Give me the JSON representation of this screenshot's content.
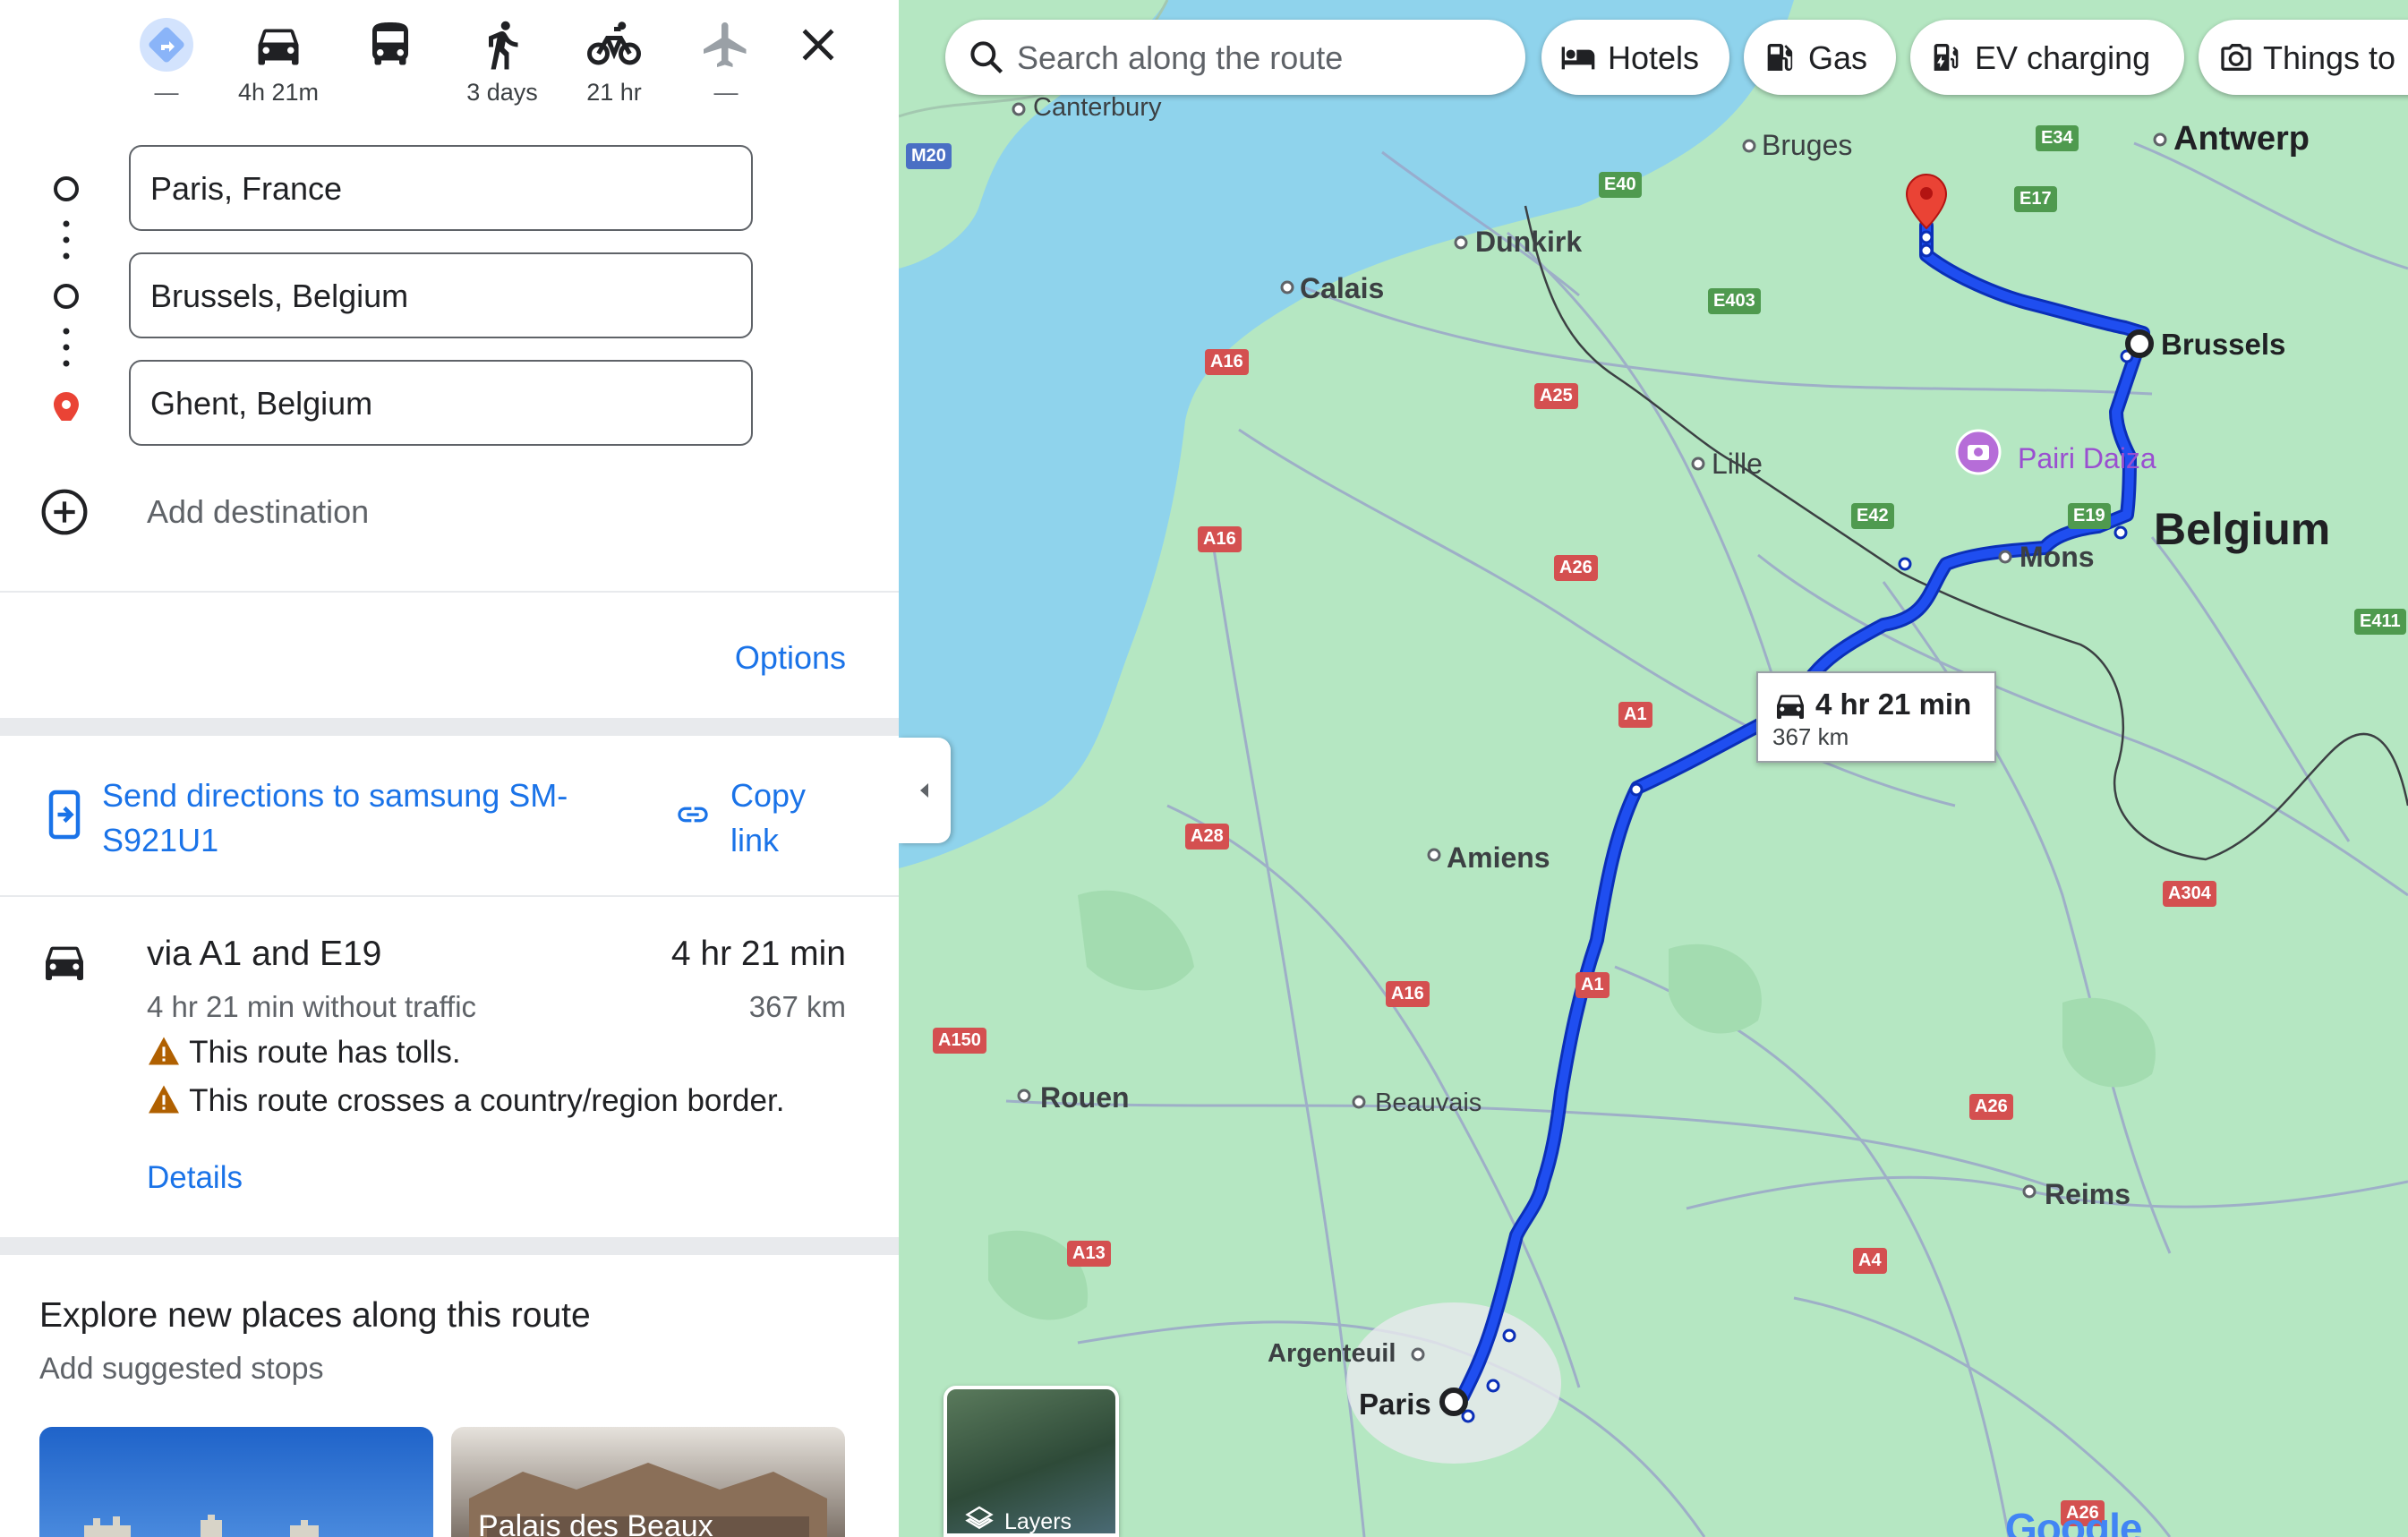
{
  "travel_modes": [
    {
      "name": "best",
      "label": "—"
    },
    {
      "name": "driving",
      "label": "4h 21m"
    },
    {
      "name": "transit",
      "label": ""
    },
    {
      "name": "walking",
      "label": "3 days"
    },
    {
      "name": "cycling",
      "label": "21 hr"
    },
    {
      "name": "flights",
      "label": "—"
    }
  ],
  "waypoints": [
    {
      "value": "Paris, France"
    },
    {
      "value": "Brussels, Belgium"
    },
    {
      "value": "Ghent, Belgium"
    }
  ],
  "add_destination": "Add destination",
  "options_label": "Options",
  "send_directions_label": "Send directions to samsung SM-S921U1",
  "send_line1": "Send directions to samsung SM-",
  "send_line2": "S921U1",
  "copy_link_line1": "Copy",
  "copy_link_line2": "link",
  "route": {
    "via": "via A1 and E19",
    "duration": "4 hr 21 min",
    "without_traffic": "4 hr 21 min without traffic",
    "distance": "367 km",
    "warnings": [
      "This route has tolls.",
      "This route crosses a country/region border."
    ],
    "details_label": "Details"
  },
  "explore": {
    "title": "Explore new places along this route",
    "subtitle": "Add suggested stops",
    "cards": [
      "",
      "Palais des Beaux"
    ]
  },
  "map": {
    "search_placeholder": "Search along the route",
    "chips": [
      "Hotels",
      "Gas",
      "EV charging",
      "Things to"
    ],
    "route_callout": {
      "duration": "4 hr 21 min",
      "distance": "367 km"
    },
    "layers_label": "Layers",
    "places": {
      "canterbury": "Canterbury",
      "bruges": "Bruges",
      "antwerp": "Antwerp",
      "dunkirk": "Dunkirk",
      "calais": "Calais",
      "brussels": "Brussels",
      "lille": "Lille",
      "pairi_daiza": "Pairi Daiza",
      "mons": "Mons",
      "belgium": "Belgium",
      "amiens": "Amiens",
      "rouen": "Rouen",
      "beauvais": "Beauvais",
      "reims": "Reims",
      "argenteuil": "Argenteuil",
      "paris": "Paris"
    },
    "roads": {
      "m20": "M20",
      "e34": "E34",
      "e40": "E40",
      "e17": "E17",
      "e403": "E403",
      "a16a": "A16",
      "a25": "A25",
      "a16b": "A16",
      "e42": "E42",
      "e19": "E19",
      "a26a": "A26",
      "e411": "E411",
      "a1a": "A1",
      "a28": "A28",
      "a304": "A304",
      "a1b": "A1",
      "a16c": "A16",
      "a150": "A150",
      "a26b": "A26",
      "a13": "A13",
      "a4": "A4",
      "a26c": "A26"
    },
    "logo": "Google"
  },
  "colors": {
    "route": "#1a3fd9",
    "water": "#8fd3ec",
    "land": "#b5e7c2",
    "accent": "#1a73e8",
    "pin": "#ea4335"
  }
}
